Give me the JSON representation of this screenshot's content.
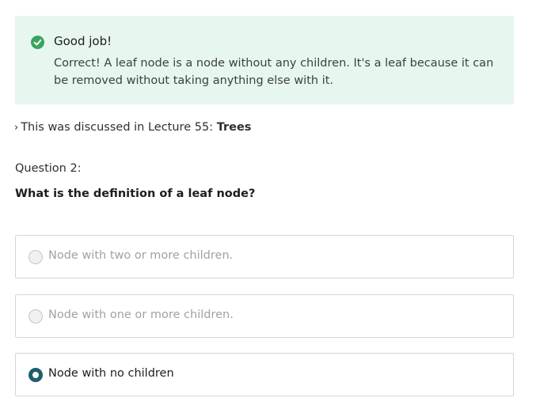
{
  "feedback": {
    "title": "Good job!",
    "message": "Correct! A leaf node is a node without any children. It's a leaf because it can be removed without taking anything else with it.",
    "status_color": "#3aa35f",
    "icon": "check-circle-icon"
  },
  "lecture_ref": {
    "chevron": "›",
    "prefix": "This was discussed in Lecture 55: ",
    "title": "Trees"
  },
  "question": {
    "number_label": "Question 2:",
    "text": "What is the definition of a leaf node?"
  },
  "options": [
    {
      "label": "Node with two or more children.",
      "selected": false,
      "disabled": true
    },
    {
      "label": "Node with one or more children.",
      "selected": false,
      "disabled": true
    },
    {
      "label": "Node with no children",
      "selected": true,
      "disabled": false
    }
  ],
  "colors": {
    "success_bg": "#e7f6ee",
    "accent": "#1f5e6f"
  }
}
